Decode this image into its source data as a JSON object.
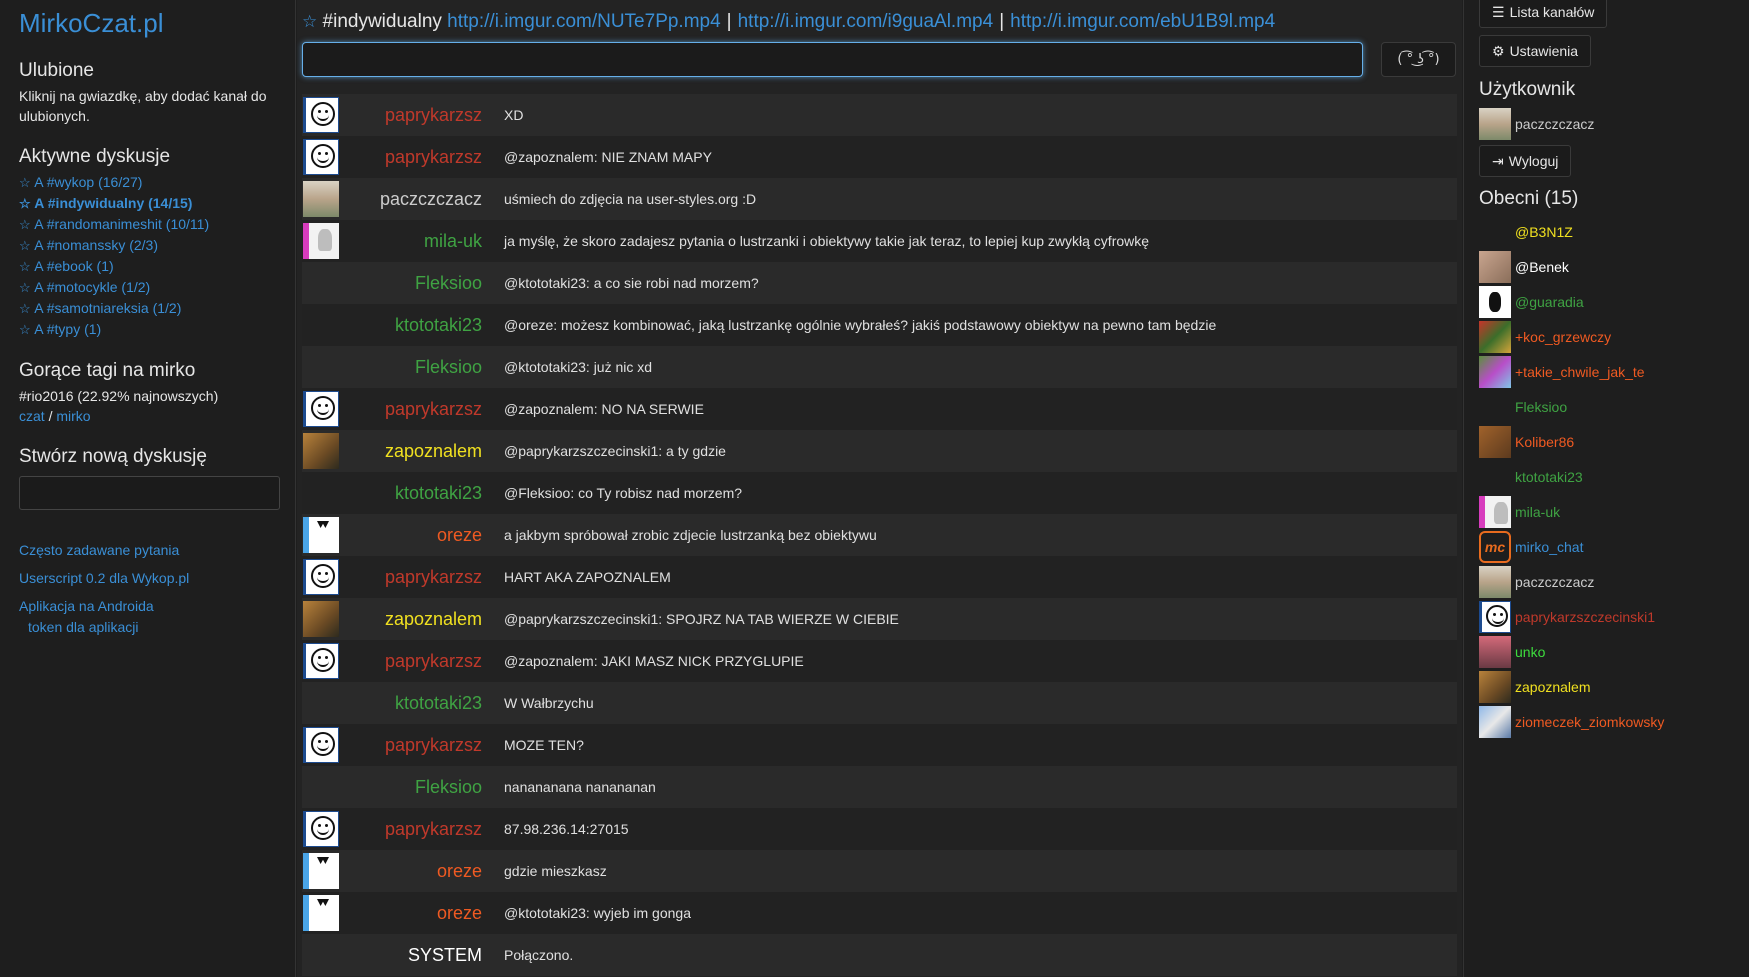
{
  "left": {
    "brand": "MirkoCzat.pl",
    "favorites_title": "Ulubione",
    "favorites_hint": "Kliknij na gwiazdkę, aby dodać kanał do ulubionych.",
    "active_title": "Aktywne dyskusje",
    "active_items": [
      {
        "label": "A #wykop (16/27)",
        "active": false
      },
      {
        "label": "A #indywidualny (14/15)",
        "active": true
      },
      {
        "label": "A #randomanimeshit (10/11)",
        "active": false
      },
      {
        "label": "A #nomanssky (2/3)",
        "active": false
      },
      {
        "label": "A #ebook (1)",
        "active": false
      },
      {
        "label": "A #motocykle (1/2)",
        "active": false
      },
      {
        "label": "A #samotniareksia (1/2)",
        "active": false
      },
      {
        "label": "A #typy (1)",
        "active": false
      }
    ],
    "hot_title": "Gorące tagi na mirko",
    "hot_text": "#rio2016 (22.92% najnowszych)",
    "hot_link1": "czat",
    "hot_sep": "/",
    "hot_link2": "mirko",
    "create_title": "Stwórz nową dyskusję",
    "links": {
      "faq": "Często zadawane pytania",
      "userscript": "Userscript 0.2 dla Wykop.pl",
      "android": "Aplikacja na Androida",
      "token": "token dla aplikacji"
    }
  },
  "main": {
    "channel": "#indywidualny",
    "topic_links": [
      "http://i.imgur.com/NUTe7Pp.mp4",
      "http://i.imgur.com/i9guaAl.mp4",
      "http://i.imgur.com/ebU1B9l.mp4"
    ],
    "topic_sep": "|",
    "lenny_label": "( ͡° ͜ʖ ͡°)",
    "messages": [
      {
        "avatar": "smile",
        "nick": "paprykarzsz",
        "color": "#c0392b",
        "text": "XD"
      },
      {
        "avatar": "smile",
        "nick": "paprykarzsz",
        "color": "#c0392b",
        "text": "@zapoznalem: NIE ZNAM MAPY"
      },
      {
        "avatar": "photo",
        "nick": "paczczczacz",
        "color": "#cccccc",
        "text": "uśmiech do zdjęcia na user-styles.org :D"
      },
      {
        "avatar": "mila",
        "nick": "mila-uk",
        "color": "#3fa343",
        "text": "ja myślę, że skoro zadajesz pytania o lustrzanki i obiektywy takie jak teraz, to lepiej kup zwykłą cyfrowkę"
      },
      {
        "avatar": "none",
        "nick": "Fleksioo",
        "color": "#3fa343",
        "text": "@ktototaki23: a co sie robi nad morzem?"
      },
      {
        "avatar": "none",
        "nick": "ktototaki23",
        "color": "#3fa343",
        "text": "@oreze: możesz kombinować, jaką lustrzankę ogólnie wybrałeś? jakiś podstawowy obiektyw na pewno tam będzie"
      },
      {
        "avatar": "none",
        "nick": "Fleksioo",
        "color": "#3fa343",
        "text": "@ktototaki23: już nic xd"
      },
      {
        "avatar": "smile",
        "nick": "paprykarzsz",
        "color": "#c0392b",
        "text": "@zapoznalem: NO NA SERWIE"
      },
      {
        "avatar": "zap",
        "nick": "zapoznalem",
        "color": "#f0e020",
        "text": "@paprykarzszczecinski1: a ty gdzie"
      },
      {
        "avatar": "none",
        "nick": "ktototaki23",
        "color": "#3fa343",
        "text": "@Fleksioo: co Ty robisz nad morzem?"
      },
      {
        "avatar": "oreze",
        "nick": "oreze",
        "color": "#ef5a22",
        "text": "a jakbym spróbował zrobic zdjecie lustrzanką bez obiektywu"
      },
      {
        "avatar": "smile",
        "nick": "paprykarzsz",
        "color": "#c0392b",
        "text": "HART AKA ZAPOZNALEM"
      },
      {
        "avatar": "zap",
        "nick": "zapoznalem",
        "color": "#f0e020",
        "text": "@paprykarzszczecinski1: SPOJRZ NA TAB WIERZE W CIEBIE"
      },
      {
        "avatar": "smile",
        "nick": "paprykarzsz",
        "color": "#c0392b",
        "text": "@zapoznalem: JAKI MASZ NICK PRZYGLUPIE"
      },
      {
        "avatar": "none",
        "nick": "ktototaki23",
        "color": "#3fa343",
        "text": "W Wałbrzychu"
      },
      {
        "avatar": "smile",
        "nick": "paprykarzsz",
        "color": "#c0392b",
        "text": "MOZE TEN?"
      },
      {
        "avatar": "none",
        "nick": "Fleksioo",
        "color": "#3fa343",
        "text": "nanananana nanananan"
      },
      {
        "avatar": "smile",
        "nick": "paprykarzsz",
        "color": "#c0392b",
        "text": "87.98.236.14:27015"
      },
      {
        "avatar": "oreze",
        "nick": "oreze",
        "color": "#ef5a22",
        "text": "gdzie mieszkasz"
      },
      {
        "avatar": "oreze",
        "nick": "oreze",
        "color": "#ef5a22",
        "text": "@ktototaki23: wyjeb im gonga"
      },
      {
        "avatar": "none",
        "nick": "SYSTEM",
        "color": "#ffffff",
        "text": "Połączono."
      }
    ]
  },
  "right": {
    "channels_btn": "Lista kanałów",
    "settings_btn": "Ustawienia",
    "user_title": "Użytkownik",
    "username": "paczczczacz",
    "logout_btn": "Wyloguj",
    "present_title": "Obecni (15)",
    "present": [
      {
        "avatar": "none",
        "name": "@B3N1Z",
        "color": "#f0e020"
      },
      {
        "avatar": "benek",
        "name": "@Benek",
        "color": "#ffffff"
      },
      {
        "avatar": "guar",
        "name": "@guaradia",
        "color": "#3fa343"
      },
      {
        "avatar": "koc",
        "name": "+koc_grzewczy",
        "color": "#ef5a22"
      },
      {
        "avatar": "takie",
        "name": "+takie_chwile_jak_te",
        "color": "#ef5a22"
      },
      {
        "avatar": "none",
        "name": "Fleksioo",
        "color": "#3fa343"
      },
      {
        "avatar": "kol",
        "name": "Koliber86",
        "color": "#ef5a22"
      },
      {
        "avatar": "none",
        "name": "ktototaki23",
        "color": "#3fa343"
      },
      {
        "avatar": "mila",
        "name": "mila-uk",
        "color": "#3fa343"
      },
      {
        "avatar": "mc",
        "name": "mirko_chat",
        "color": "#3a8fd6"
      },
      {
        "avatar": "photo",
        "name": "paczczczacz",
        "color": "#cccccc"
      },
      {
        "avatar": "smile",
        "name": "paprykarzszczecinski1",
        "color": "#c0392b"
      },
      {
        "avatar": "unko",
        "name": "unko",
        "color": "#3ddc3d"
      },
      {
        "avatar": "zap",
        "name": "zapoznalem",
        "color": "#f0e020"
      },
      {
        "avatar": "ziom",
        "name": "ziomeczek_ziomkowsky",
        "color": "#ef5a22"
      }
    ]
  }
}
